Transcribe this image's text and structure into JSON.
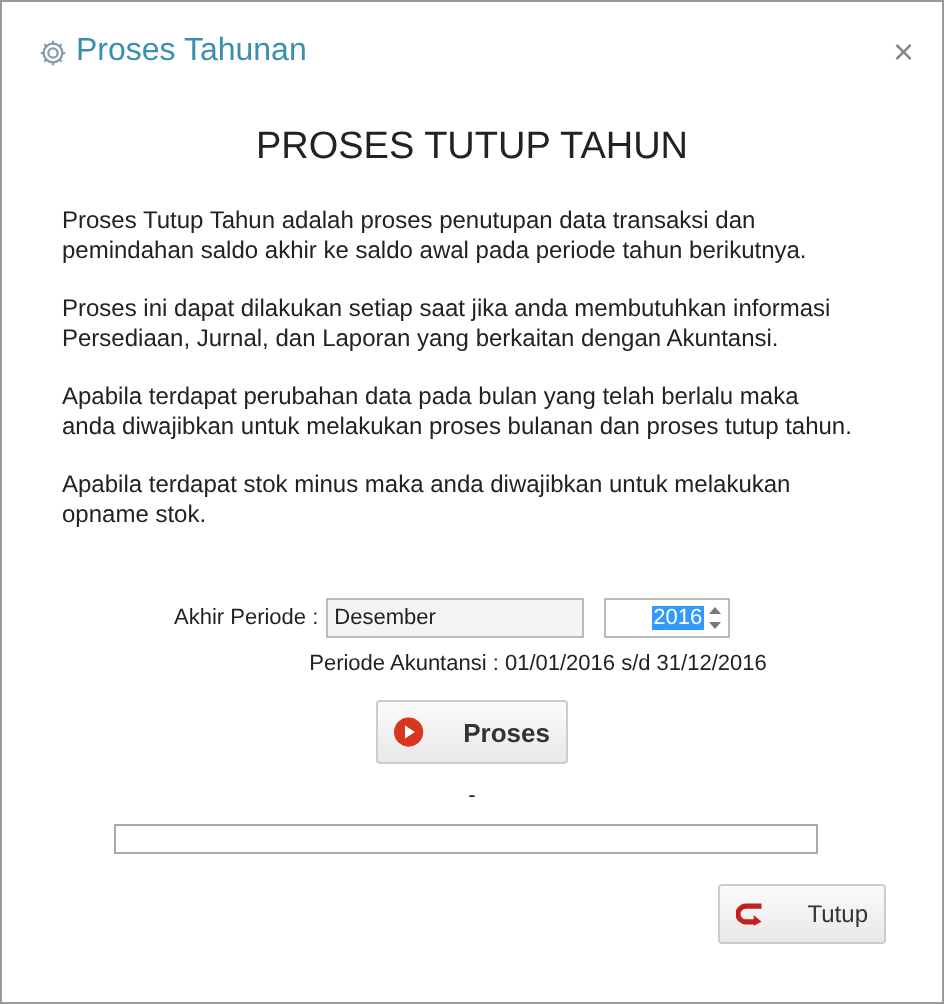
{
  "window": {
    "title": "Proses Tahunan",
    "close": "×"
  },
  "heading": "PROSES TUTUP TAHUN",
  "paragraphs": [
    "Proses Tutup Tahun adalah proses penutupan data transaksi dan pemindahan saldo akhir ke saldo awal pada periode tahun berikutnya.",
    "Proses ini dapat dilakukan setiap saat jika anda membutuhkan informasi Persediaan, Jurnal, dan Laporan yang berkaitan dengan Akuntansi.",
    "Apabila terdapat perubahan data pada bulan yang telah berlalu maka anda diwajibkan untuk melakukan proses bulanan dan proses tutup tahun.",
    "Apabila terdapat stok minus maka anda diwajibkan untuk melakukan opname stok."
  ],
  "period": {
    "label": "Akhir Periode :",
    "month": "Desember",
    "year": "2016"
  },
  "accounting_period": "Periode Akuntansi : 01/01/2016 s/d 31/12/2016",
  "process_button": "Proses",
  "status": "-",
  "progress": {
    "level": 0
  },
  "close_button": "Tutup"
}
